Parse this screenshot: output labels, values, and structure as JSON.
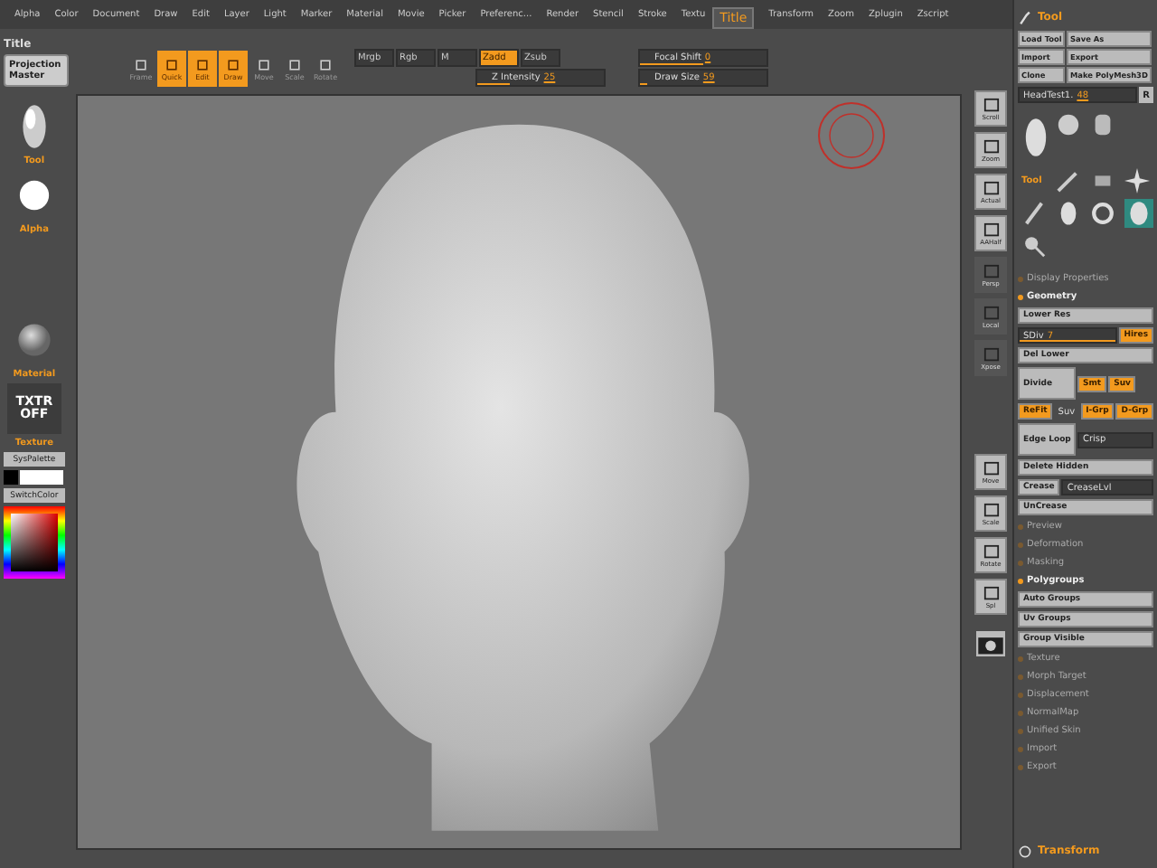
{
  "menu": [
    "Alpha",
    "Color",
    "Document",
    "Draw",
    "Edit",
    "Layer",
    "Light",
    "Marker",
    "Material",
    "Movie",
    "Picker",
    "Preferenc...",
    "Render",
    "Stencil",
    "Stroke",
    "Textu"
  ],
  "tooltip": "Title",
  "menu_right": [
    "Transform",
    "Zoom",
    "Zplugin",
    "Zscript"
  ],
  "toolbar": {
    "title": "Title",
    "projection_master": "Projection Master",
    "transform_buttons": [
      {
        "label": "Frame",
        "selected": false
      },
      {
        "label": "Quick",
        "selected": true
      },
      {
        "label": "Edit",
        "selected": true
      },
      {
        "label": "Draw",
        "selected": true
      },
      {
        "label": "Move",
        "selected": false
      },
      {
        "label": "Scale",
        "selected": false
      },
      {
        "label": "Rotate",
        "selected": false
      }
    ],
    "modes": [
      {
        "label": "Mrgb",
        "selected": false
      },
      {
        "label": "Rgb",
        "selected": false
      },
      {
        "label": "M",
        "selected": false
      },
      {
        "label": "Zadd",
        "selected": true
      },
      {
        "label": "Zsub",
        "selected": false
      }
    ],
    "sliders": [
      {
        "label": "Z Intensity",
        "reading": "25",
        "level": 0.25
      },
      {
        "label": "Focal Shift",
        "reading": "0",
        "level": 0.5
      },
      {
        "label": "Draw Size",
        "reading": "59",
        "level": 0.06
      }
    ]
  },
  "left": {
    "tool_label": "Tool",
    "alpha_label": "Alpha",
    "material_label": "Material",
    "texture_thumb": "TXTR OFF",
    "texture_label": "Texture",
    "sys_palette": "SysPalette",
    "switch_color": "SwitchColor"
  },
  "shelf": [
    {
      "label": "Scroll",
      "disabled": false
    },
    {
      "label": "Zoom",
      "disabled": false
    },
    {
      "label": "Actual",
      "disabled": false
    },
    {
      "label": "AAHalf",
      "disabled": false
    },
    {
      "label": "Persp",
      "disabled": true
    },
    {
      "label": "Local",
      "disabled": true
    },
    {
      "label": "Xpose",
      "disabled": true
    },
    {
      "label": "Move",
      "disabled": false
    },
    {
      "label": "Scale",
      "disabled": false
    },
    {
      "label": "Rotate",
      "disabled": false
    },
    {
      "label": "Spl",
      "disabled": false
    }
  ],
  "panel": {
    "title": "Tool",
    "file_buttons": [
      "Load Tool",
      "Save As",
      "Import",
      "Export",
      "Clone",
      "Make PolyMesh3D"
    ],
    "mesh_slider": {
      "label": "HeadTest1.",
      "reading": "48"
    },
    "r_button": "R",
    "tool_label": "Tool",
    "items": [
      {
        "kind": "section",
        "label": "Display Properties",
        "expanded": false
      },
      {
        "kind": "section",
        "label": "Geometry",
        "expanded": true
      },
      {
        "kind": "row",
        "items": [
          {
            "kind": "button",
            "label": "Lower Res",
            "selected": false
          }
        ]
      },
      {
        "kind": "row",
        "items": [
          {
            "kind": "slider",
            "label": "SDiv",
            "reading": "7",
            "level": 1
          },
          {
            "kind": "button",
            "label": "Hires",
            "selected": true
          }
        ]
      },
      {
        "kind": "row",
        "items": [
          {
            "kind": "button",
            "label": "Del Lower",
            "selected": false
          }
        ]
      },
      {
        "kind": "row",
        "items": [
          {
            "kind": "big",
            "label": "Divide",
            "selected": false
          },
          {
            "kind": "button",
            "label": "Smt",
            "selected": true
          },
          {
            "kind": "button",
            "label": "Suv",
            "selected": true
          }
        ]
      },
      {
        "kind": "row",
        "items": [
          {
            "kind": "button",
            "label": "ReFit",
            "selected": true
          },
          {
            "kind": "text",
            "label": "Suv"
          },
          {
            "kind": "button",
            "label": "I-Grp",
            "selected": true
          },
          {
            "kind": "button",
            "label": "D-Grp",
            "selected": true
          }
        ]
      },
      {
        "kind": "row",
        "items": [
          {
            "kind": "big",
            "label": "Edge Loop",
            "selected": false
          },
          {
            "kind": "field",
            "label": "Crisp"
          }
        ]
      },
      {
        "kind": "row",
        "items": [
          {
            "kind": "button",
            "label": "Delete Hidden",
            "selected": false
          }
        ]
      },
      {
        "kind": "row",
        "items": [
          {
            "kind": "button",
            "label": "Crease",
            "selected": false
          },
          {
            "kind": "field",
            "label": "CreaseLvl"
          }
        ]
      },
      {
        "kind": "row",
        "items": [
          {
            "kind": "button",
            "label": "UnCrease",
            "selected": false
          }
        ]
      },
      {
        "kind": "section",
        "label": "Preview",
        "expanded": false
      },
      {
        "kind": "section",
        "label": "Deformation",
        "expanded": false
      },
      {
        "kind": "section",
        "label": "Masking",
        "expanded": false
      },
      {
        "kind": "section",
        "label": "Polygroups",
        "expanded": true
      },
      {
        "kind": "row",
        "items": [
          {
            "kind": "button",
            "label": "Auto Groups",
            "selected": false
          }
        ]
      },
      {
        "kind": "row",
        "items": [
          {
            "kind": "button",
            "label": "Uv Groups",
            "selected": false
          }
        ]
      },
      {
        "kind": "row",
        "items": [
          {
            "kind": "button",
            "label": "Group Visible",
            "selected": false
          }
        ]
      },
      {
        "kind": "section",
        "label": "Texture",
        "expanded": false
      },
      {
        "kind": "section",
        "label": "Morph Target",
        "expanded": false
      },
      {
        "kind": "section",
        "label": "Displacement",
        "expanded": false
      },
      {
        "kind": "section",
        "label": "NormalMap",
        "expanded": false
      },
      {
        "kind": "section",
        "label": "Unified Skin",
        "expanded": false
      },
      {
        "kind": "section",
        "label": "Import",
        "expanded": false
      },
      {
        "kind": "section",
        "label": "Export",
        "expanded": false
      }
    ],
    "footer": "Transform"
  }
}
